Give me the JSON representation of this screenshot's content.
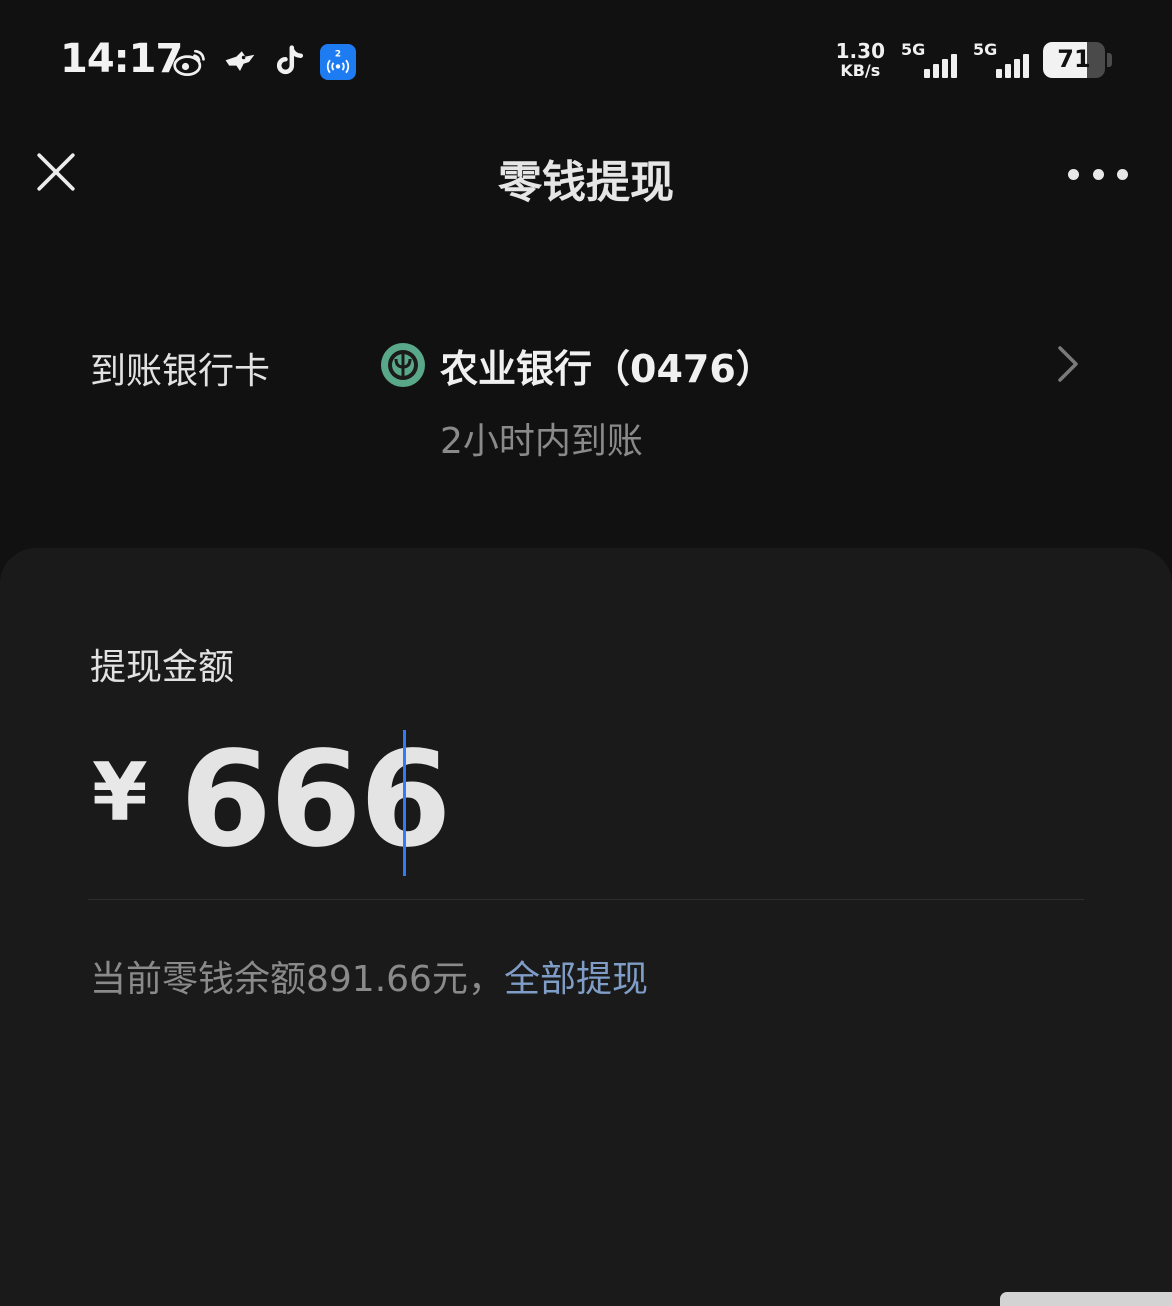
{
  "status_bar": {
    "time": "14:17",
    "notification_icons": [
      "weibo-icon",
      "bird-app-icon",
      "tiktok-icon",
      "hotspot-app-icon"
    ],
    "hotspot_badge": "2",
    "net_speed_value": "1.30",
    "net_speed_unit": "KB/s",
    "sim1_label": "5G",
    "sim2_label": "5G",
    "battery_level": "71",
    "battery_fraction": 0.71
  },
  "nav": {
    "title": "零钱提现",
    "close_icon": "close-icon",
    "more_icon": "more-icon"
  },
  "bank": {
    "label": "到账银行卡",
    "name": "农业银行（0476）",
    "eta": "2小时内到账",
    "logo_color": "#5aa88a"
  },
  "amount": {
    "label": "提现金额",
    "currency_symbol": "¥",
    "value": "666"
  },
  "balance": {
    "text": "当前零钱余额891.66元，",
    "withdraw_all_label": "全部提现"
  },
  "colors": {
    "background": "#111111",
    "panel": "#1a1a1a",
    "accent_link": "#7f9dc6",
    "caret": "#2f7df6"
  }
}
